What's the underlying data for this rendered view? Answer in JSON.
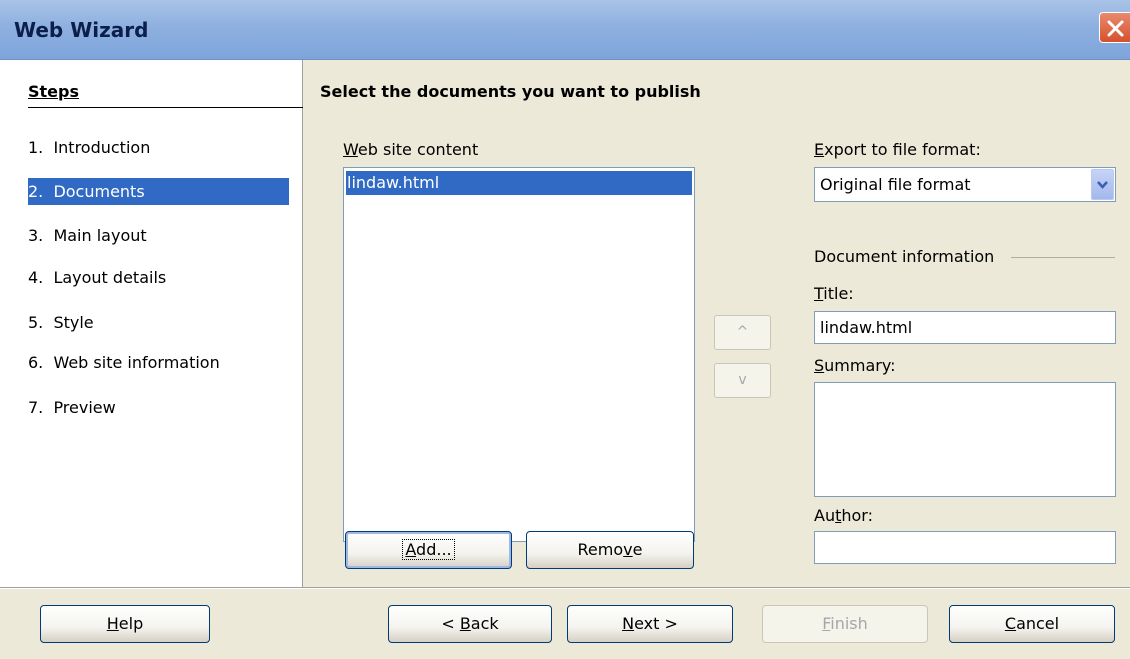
{
  "window": {
    "title": "Web Wizard",
    "close_icon": "close-icon",
    "close_color": "#d6512c"
  },
  "steps": {
    "title": "Steps",
    "items": [
      {
        "num": "1.",
        "label": "Introduction"
      },
      {
        "num": "2.",
        "label": "Documents",
        "active": true
      },
      {
        "num": "3.",
        "label": "Main layout"
      },
      {
        "num": "4.",
        "label": "Layout details"
      },
      {
        "num": "5.",
        "label": "Style"
      },
      {
        "num": "6.",
        "label": "Web site information"
      },
      {
        "num": "7.",
        "label": "Preview"
      }
    ]
  },
  "main": {
    "heading": "Select the documents you want to publish",
    "content_label": {
      "mnemonic": "W",
      "rest": "eb site content"
    },
    "content_items": [
      "lindaw.html"
    ],
    "add_button": {
      "before": "",
      "mnemonic": "A",
      "after": "dd..."
    },
    "remove_button": {
      "before": "Remo",
      "mnemonic": "v",
      "after": "e"
    },
    "move_up": "^",
    "move_down": "v",
    "export_label": {
      "mnemonic": "E",
      "rest": "xport to file format:"
    },
    "export_value": "Original file format",
    "doc_info_label": "Document information",
    "title_label": {
      "mnemonic": "T",
      "rest": "itle:"
    },
    "title_value": "lindaw.html",
    "summary_label": {
      "mnemonic": "S",
      "rest": "ummary:"
    },
    "summary_value": "",
    "author_label": {
      "before": "Au",
      "mnemonic": "t",
      "after": "hor:"
    },
    "author_value": ""
  },
  "footer": {
    "help": {
      "before": "",
      "mnemonic": "H",
      "after": "elp"
    },
    "back": {
      "before": "< ",
      "mnemonic": "B",
      "after": "ack"
    },
    "next": {
      "before": "",
      "mnemonic": "N",
      "after": "ext >"
    },
    "finish": {
      "before": "",
      "mnemonic": "F",
      "after": "inish"
    },
    "cancel": {
      "before": "",
      "mnemonic": "C",
      "after": "ancel"
    }
  },
  "colors": {
    "selection": "#316ac5",
    "dialog_bg": "#ece9d8"
  }
}
